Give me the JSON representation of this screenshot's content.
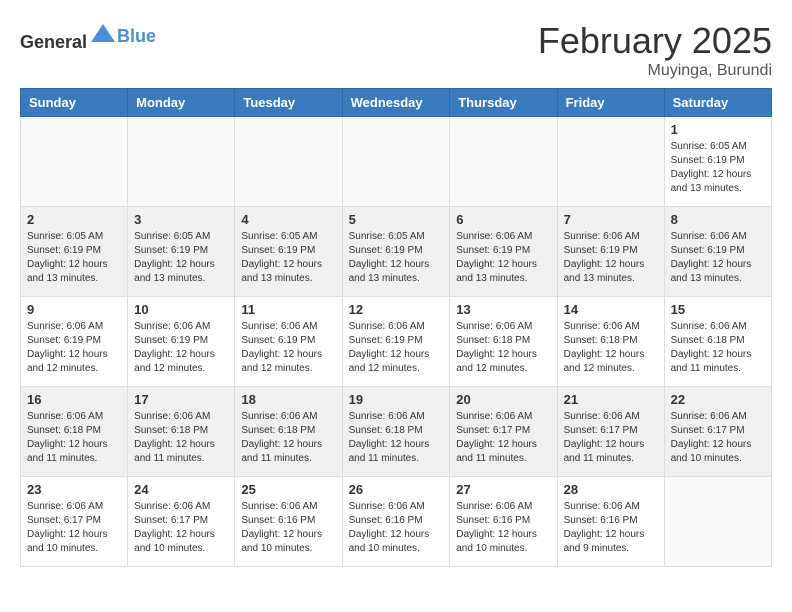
{
  "header": {
    "logo_general": "General",
    "logo_blue": "Blue",
    "month_year": "February 2025",
    "location": "Muyinga, Burundi"
  },
  "weekdays": [
    "Sunday",
    "Monday",
    "Tuesday",
    "Wednesday",
    "Thursday",
    "Friday",
    "Saturday"
  ],
  "weeks": [
    [
      {
        "day": "",
        "info": ""
      },
      {
        "day": "",
        "info": ""
      },
      {
        "day": "",
        "info": ""
      },
      {
        "day": "",
        "info": ""
      },
      {
        "day": "",
        "info": ""
      },
      {
        "day": "",
        "info": ""
      },
      {
        "day": "1",
        "info": "Sunrise: 6:05 AM\nSunset: 6:19 PM\nDaylight: 12 hours\nand 13 minutes."
      }
    ],
    [
      {
        "day": "2",
        "info": "Sunrise: 6:05 AM\nSunset: 6:19 PM\nDaylight: 12 hours\nand 13 minutes."
      },
      {
        "day": "3",
        "info": "Sunrise: 6:05 AM\nSunset: 6:19 PM\nDaylight: 12 hours\nand 13 minutes."
      },
      {
        "day": "4",
        "info": "Sunrise: 6:05 AM\nSunset: 6:19 PM\nDaylight: 12 hours\nand 13 minutes."
      },
      {
        "day": "5",
        "info": "Sunrise: 6:05 AM\nSunset: 6:19 PM\nDaylight: 12 hours\nand 13 minutes."
      },
      {
        "day": "6",
        "info": "Sunrise: 6:06 AM\nSunset: 6:19 PM\nDaylight: 12 hours\nand 13 minutes."
      },
      {
        "day": "7",
        "info": "Sunrise: 6:06 AM\nSunset: 6:19 PM\nDaylight: 12 hours\nand 13 minutes."
      },
      {
        "day": "8",
        "info": "Sunrise: 6:06 AM\nSunset: 6:19 PM\nDaylight: 12 hours\nand 13 minutes."
      }
    ],
    [
      {
        "day": "9",
        "info": "Sunrise: 6:06 AM\nSunset: 6:19 PM\nDaylight: 12 hours\nand 12 minutes."
      },
      {
        "day": "10",
        "info": "Sunrise: 6:06 AM\nSunset: 6:19 PM\nDaylight: 12 hours\nand 12 minutes."
      },
      {
        "day": "11",
        "info": "Sunrise: 6:06 AM\nSunset: 6:19 PM\nDaylight: 12 hours\nand 12 minutes."
      },
      {
        "day": "12",
        "info": "Sunrise: 6:06 AM\nSunset: 6:19 PM\nDaylight: 12 hours\nand 12 minutes."
      },
      {
        "day": "13",
        "info": "Sunrise: 6:06 AM\nSunset: 6:18 PM\nDaylight: 12 hours\nand 12 minutes."
      },
      {
        "day": "14",
        "info": "Sunrise: 6:06 AM\nSunset: 6:18 PM\nDaylight: 12 hours\nand 12 minutes."
      },
      {
        "day": "15",
        "info": "Sunrise: 6:06 AM\nSunset: 6:18 PM\nDaylight: 12 hours\nand 11 minutes."
      }
    ],
    [
      {
        "day": "16",
        "info": "Sunrise: 6:06 AM\nSunset: 6:18 PM\nDaylight: 12 hours\nand 11 minutes."
      },
      {
        "day": "17",
        "info": "Sunrise: 6:06 AM\nSunset: 6:18 PM\nDaylight: 12 hours\nand 11 minutes."
      },
      {
        "day": "18",
        "info": "Sunrise: 6:06 AM\nSunset: 6:18 PM\nDaylight: 12 hours\nand 11 minutes."
      },
      {
        "day": "19",
        "info": "Sunrise: 6:06 AM\nSunset: 6:18 PM\nDaylight: 12 hours\nand 11 minutes."
      },
      {
        "day": "20",
        "info": "Sunrise: 6:06 AM\nSunset: 6:17 PM\nDaylight: 12 hours\nand 11 minutes."
      },
      {
        "day": "21",
        "info": "Sunrise: 6:06 AM\nSunset: 6:17 PM\nDaylight: 12 hours\nand 11 minutes."
      },
      {
        "day": "22",
        "info": "Sunrise: 6:06 AM\nSunset: 6:17 PM\nDaylight: 12 hours\nand 10 minutes."
      }
    ],
    [
      {
        "day": "23",
        "info": "Sunrise: 6:06 AM\nSunset: 6:17 PM\nDaylight: 12 hours\nand 10 minutes."
      },
      {
        "day": "24",
        "info": "Sunrise: 6:06 AM\nSunset: 6:17 PM\nDaylight: 12 hours\nand 10 minutes."
      },
      {
        "day": "25",
        "info": "Sunrise: 6:06 AM\nSunset: 6:16 PM\nDaylight: 12 hours\nand 10 minutes."
      },
      {
        "day": "26",
        "info": "Sunrise: 6:06 AM\nSunset: 6:16 PM\nDaylight: 12 hours\nand 10 minutes."
      },
      {
        "day": "27",
        "info": "Sunrise: 6:06 AM\nSunset: 6:16 PM\nDaylight: 12 hours\nand 10 minutes."
      },
      {
        "day": "28",
        "info": "Sunrise: 6:06 AM\nSunset: 6:16 PM\nDaylight: 12 hours\nand 9 minutes."
      },
      {
        "day": "",
        "info": ""
      }
    ]
  ]
}
